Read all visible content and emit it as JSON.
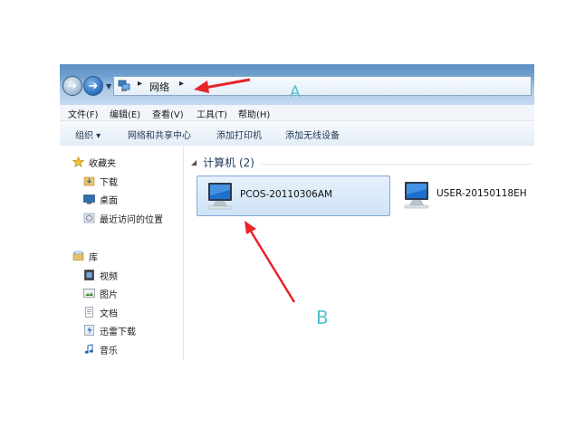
{
  "address_bar": {
    "location": "网络",
    "back_icon": "back-arrow-icon",
    "forward_icon": "forward-arrow-icon",
    "network_icon": "network-icon"
  },
  "menu": [
    "文件(F)",
    "编辑(E)",
    "查看(V)",
    "工具(T)",
    "帮助(H)"
  ],
  "toolbar": {
    "organize": "组织 ▾",
    "network_sharing_center": "网络和共享中心",
    "add_printer": "添加打印机",
    "add_wireless_device": "添加无线设备"
  },
  "sidebar": {
    "favorites": {
      "label": "收藏夹",
      "items": [
        "下载",
        "桌面",
        "最近访问的位置"
      ]
    },
    "libraries": {
      "label": "库",
      "items": [
        "视频",
        "图片",
        "文档",
        "迅雷下载",
        "音乐"
      ]
    }
  },
  "content": {
    "group_title": "计算机 (2)",
    "computers": [
      "PCOS-20110306AM",
      "USER-20150118EH"
    ],
    "selected": "PCOS-20110306AM"
  },
  "annotations": {
    "a": "A",
    "b": "B",
    "color": "#e8242b",
    "label_color": "#4ec3cd"
  }
}
